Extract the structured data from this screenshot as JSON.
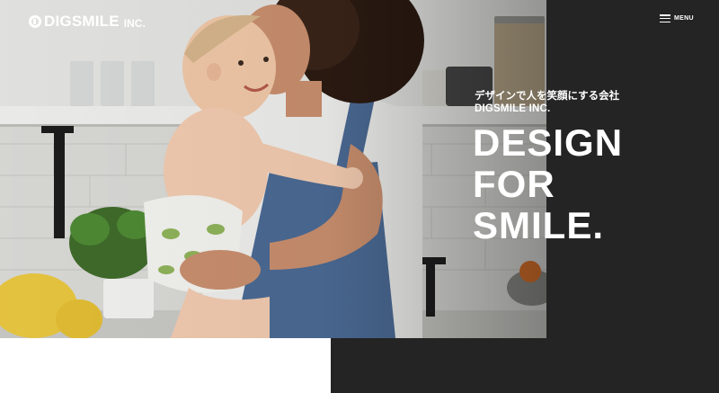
{
  "header": {
    "logo_text": "DIGSMILE",
    "logo_suffix": "INC.",
    "menu_label": "MENU"
  },
  "hero": {
    "tagline_jp": "デザインで人を笑顔にする会社",
    "tagline_en": "DIGSMILE INC.",
    "headline": [
      "DESIGN",
      "FOR",
      "SMILE."
    ]
  },
  "colors": {
    "dark_panel": "#242424",
    "text": "#ffffff",
    "bottom_white": "#ffffff"
  },
  "icons": [
    "logo-mark-icon",
    "hamburger-menu-icon"
  ]
}
